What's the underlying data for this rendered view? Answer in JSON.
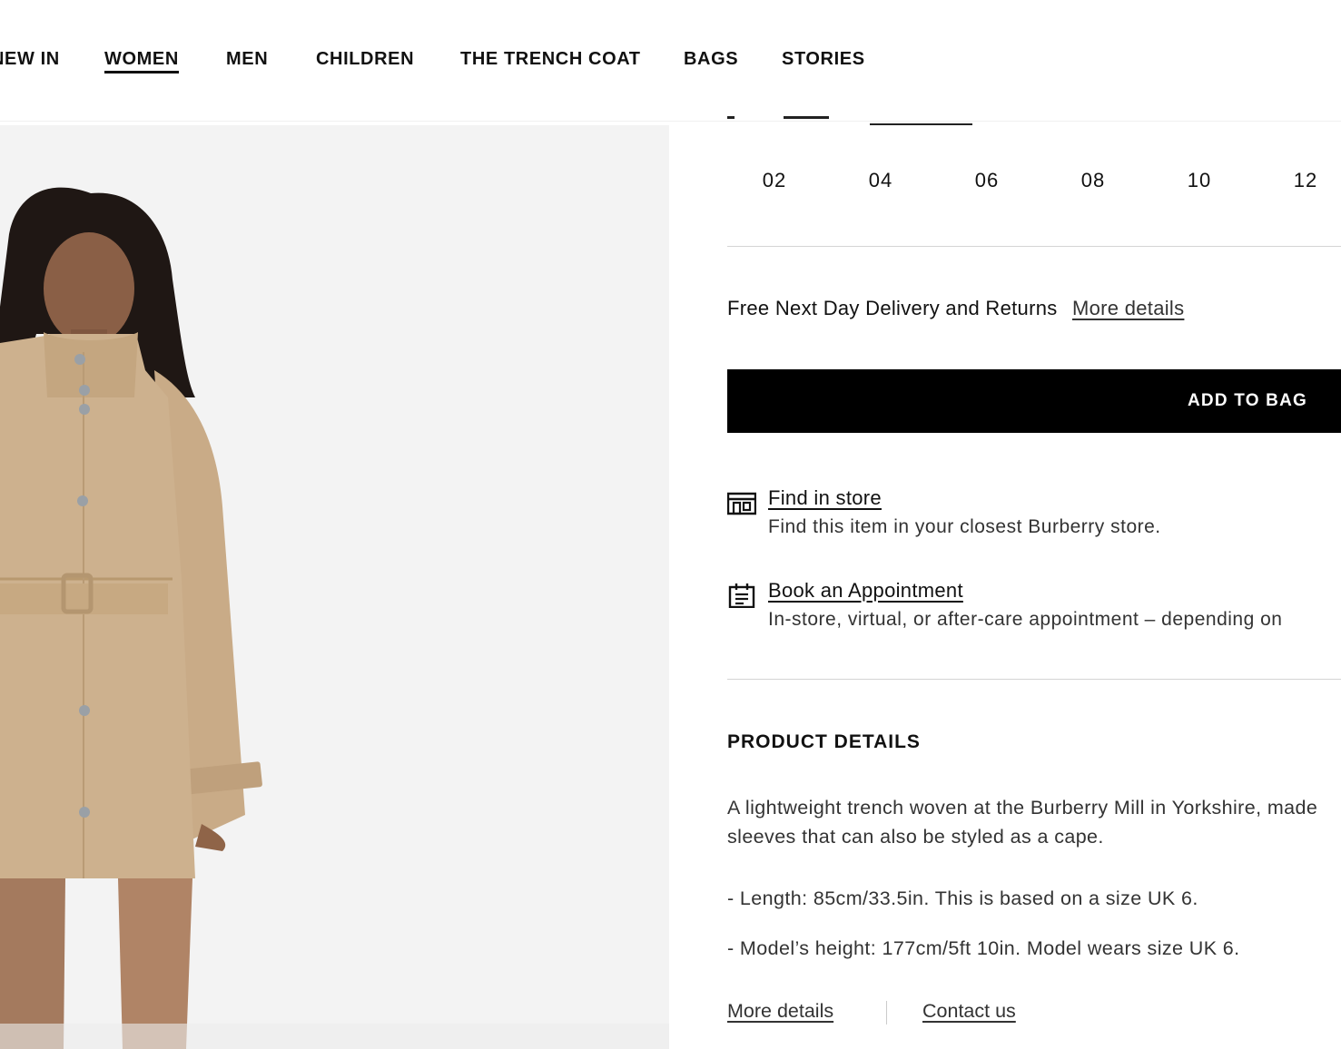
{
  "nav": {
    "items": [
      {
        "label": "NEW IN",
        "active": false
      },
      {
        "label": "WOMEN",
        "active": true
      },
      {
        "label": "MEN",
        "active": false
      },
      {
        "label": "CHILDREN",
        "active": false
      },
      {
        "label": "THE TRENCH COAT",
        "active": false
      },
      {
        "label": "BAGS",
        "active": false
      },
      {
        "label": "STORIES",
        "active": false
      }
    ]
  },
  "product": {
    "image_icon": "model-wearing-trench-coat-image",
    "sizes": [
      "02",
      "04",
      "06",
      "08",
      "10",
      "12"
    ],
    "delivery": {
      "text": "Free Next Day Delivery and Returns",
      "link": "More details"
    },
    "add_to_bag_label": "ADD TO BAG",
    "services": [
      {
        "icon": "store-icon",
        "title": "Find in store",
        "description": "Find this item in your closest Burberry store."
      },
      {
        "icon": "calendar-icon",
        "title": "Book an Appointment",
        "description": "In-store, virtual, or after-care appointment – depending on"
      }
    ],
    "details": {
      "heading": "PRODUCT DETAILS",
      "description_line1": "A lightweight trench woven at the Burberry Mill in Yorkshire, made",
      "description_line2": "sleeves that can also be styled as a cape.",
      "bullets": [
        "- Length: 85cm/33.5in. This is based on a size UK 6.",
        "- Model’s height: 177cm/5ft 10in. Model wears size UK 6."
      ],
      "more_details": "More details",
      "contact_us": "Contact us"
    }
  },
  "colors": {
    "button_bg": "#000000",
    "coat": "#cdb18e",
    "image_bg": "#f3f3f3"
  }
}
